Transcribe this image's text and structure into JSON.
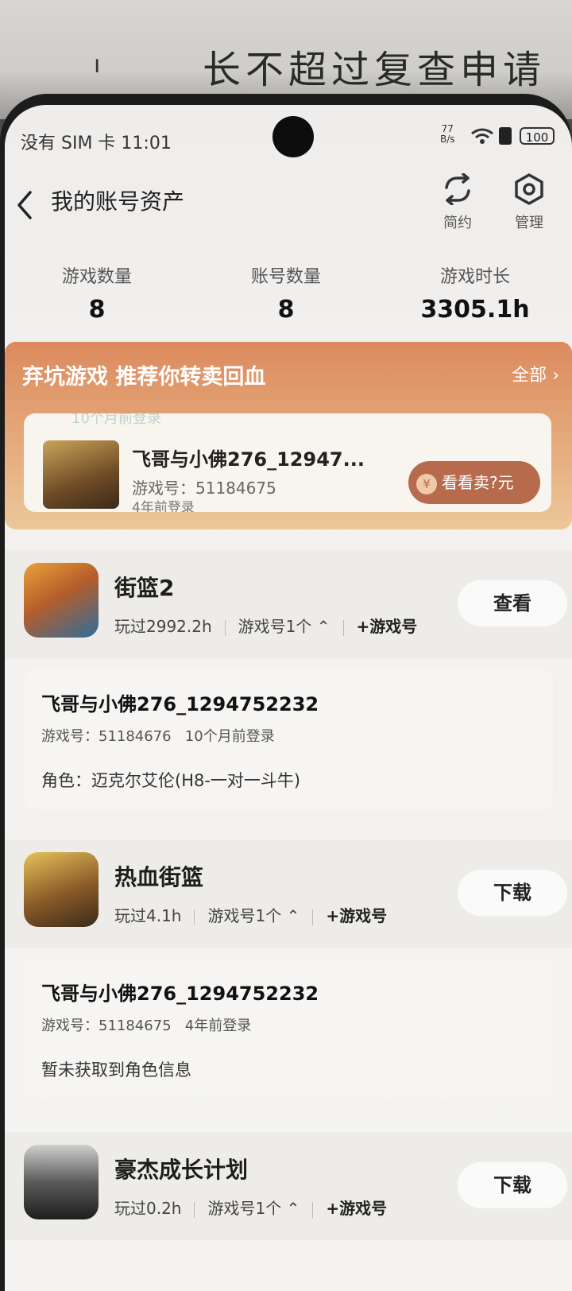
{
  "background_text": "长不超过复查申请",
  "status_bar": {
    "carrier": "没有 SIM 卡",
    "time": "11:01",
    "speed_value": "77",
    "speed_unit": "B/s",
    "battery": "100"
  },
  "header": {
    "title": "我的账号资产",
    "actions": [
      {
        "label": "简约",
        "icon": "refresh-icon"
      },
      {
        "label": "管理",
        "icon": "gear-icon"
      }
    ]
  },
  "stats": [
    {
      "label": "游戏数量",
      "value": "8"
    },
    {
      "label": "账号数量",
      "value": "8"
    },
    {
      "label": "游戏时长",
      "value": "3305.1h"
    }
  ],
  "promo": {
    "title": "弃坑游戏 推荐你转卖回血",
    "more": "全部",
    "ghost_text": "10个月前登录",
    "card": {
      "name": "飞哥与小佛276_12947...",
      "id_line": "游戏号：51184675",
      "login": "4年前登录",
      "sell_label": "看看卖?元",
      "coin_symbol": "¥"
    }
  },
  "games": [
    {
      "name": "街篮2",
      "played": "玩过2992.2h",
      "accounts": "游戏号1个",
      "add": "+游戏号",
      "button": "查看",
      "account": {
        "name": "飞哥与小佛276_1294752232",
        "id_line": "游戏号：51184676",
        "login": "10个月前登录",
        "role": "角色：迈克尔艾伦(H8-一对一斗牛)"
      }
    },
    {
      "name": "热血街篮",
      "played": "玩过4.1h",
      "accounts": "游戏号1个",
      "add": "+游戏号",
      "button": "下载",
      "account": {
        "name": "飞哥与小佛276_1294752232",
        "id_line": "游戏号：51184675",
        "login": "4年前登录",
        "role": "暂未获取到角色信息"
      }
    },
    {
      "name": "豪杰成长计划",
      "played": "玩过0.2h",
      "accounts": "游戏号1个",
      "add": "+游戏号",
      "button": "下载"
    }
  ],
  "colors": {
    "promo_top": "#dc8a5e",
    "promo_bottom": "#ecc79a",
    "sell_button": "#b86a4c"
  }
}
